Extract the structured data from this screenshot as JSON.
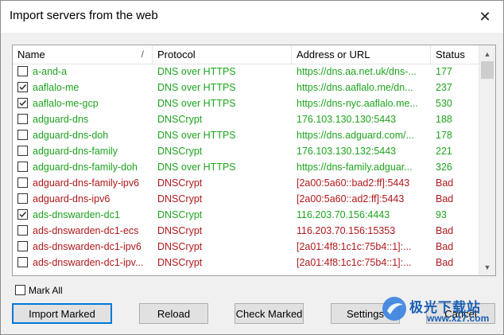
{
  "window": {
    "title": "Import servers from the web",
    "close_glyph": "✕"
  },
  "table": {
    "columns": [
      "Name",
      "Protocol",
      "Address or URL",
      "Status"
    ],
    "sort_glyph": "/",
    "rows": [
      {
        "checked": false,
        "name": "a-and-a",
        "protocol": "DNS over HTTPS",
        "address": "https://dns.aa.net.uk/dns-...",
        "status": "177",
        "state": "ok"
      },
      {
        "checked": true,
        "name": "aaflalo-me",
        "protocol": "DNS over HTTPS",
        "address": "https://dns.aaflalo.me/dn...",
        "status": "237",
        "state": "ok"
      },
      {
        "checked": true,
        "name": "aaflalo-me-gcp",
        "protocol": "DNS over HTTPS",
        "address": "https://dns-nyc.aaflalo.me...",
        "status": "530",
        "state": "ok"
      },
      {
        "checked": false,
        "name": "adguard-dns",
        "protocol": "DNSCrypt",
        "address": "176.103.130.130:5443",
        "status": "188",
        "state": "ok"
      },
      {
        "checked": false,
        "name": "adguard-dns-doh",
        "protocol": "DNS over HTTPS",
        "address": "https://dns.adguard.com/...",
        "status": "178",
        "state": "ok"
      },
      {
        "checked": false,
        "name": "adguard-dns-family",
        "protocol": "DNSCrypt",
        "address": "176.103.130.132:5443",
        "status": "221",
        "state": "ok"
      },
      {
        "checked": false,
        "name": "adguard-dns-family-doh",
        "protocol": "DNS over HTTPS",
        "address": "https://dns-family.adguar...",
        "status": "326",
        "state": "ok"
      },
      {
        "checked": false,
        "name": "adguard-dns-family-ipv6",
        "protocol": "DNSCrypt",
        "address": "[2a00:5a60::bad2:ff]:5443",
        "status": "Bad",
        "state": "bad"
      },
      {
        "checked": false,
        "name": "adguard-dns-ipv6",
        "protocol": "DNSCrypt",
        "address": "[2a00:5a60::ad2:ff]:5443",
        "status": "Bad",
        "state": "bad"
      },
      {
        "checked": true,
        "name": "ads-dnswarden-dc1",
        "protocol": "DNSCrypt",
        "address": "116.203.70.156:4443",
        "status": "93",
        "state": "ok"
      },
      {
        "checked": false,
        "name": "ads-dnswarden-dc1-ecs",
        "protocol": "DNSCrypt",
        "address": "116.203.70.156:15353",
        "status": "Bad",
        "state": "bad"
      },
      {
        "checked": false,
        "name": "ads-dnswarden-dc1-ipv6",
        "protocol": "DNSCrypt",
        "address": "[2a01:4f8:1c1c:75b4::1]:...",
        "status": "Bad",
        "state": "bad"
      },
      {
        "checked": false,
        "name": "ads-dnswarden-dc1-ipv...",
        "protocol": "DNSCrypt",
        "address": "[2a01:4f8:1c1c:75b4::1]:...",
        "status": "Bad",
        "state": "bad"
      }
    ]
  },
  "scrollbar": {
    "up_glyph": "▲",
    "down_glyph": "▼"
  },
  "mark_all": {
    "label": "Mark All",
    "checked": false
  },
  "buttons": {
    "import_marked": "Import Marked",
    "reload": "Reload",
    "check_marked": "Check Marked",
    "settings": "Settings",
    "cancel": "Cancel"
  },
  "watermark": {
    "text": "极光下载站",
    "url": "www.xz7.com"
  },
  "colors": {
    "ok": "#1ea51e",
    "bad": "#b0181b",
    "accent": "#0078d7"
  }
}
